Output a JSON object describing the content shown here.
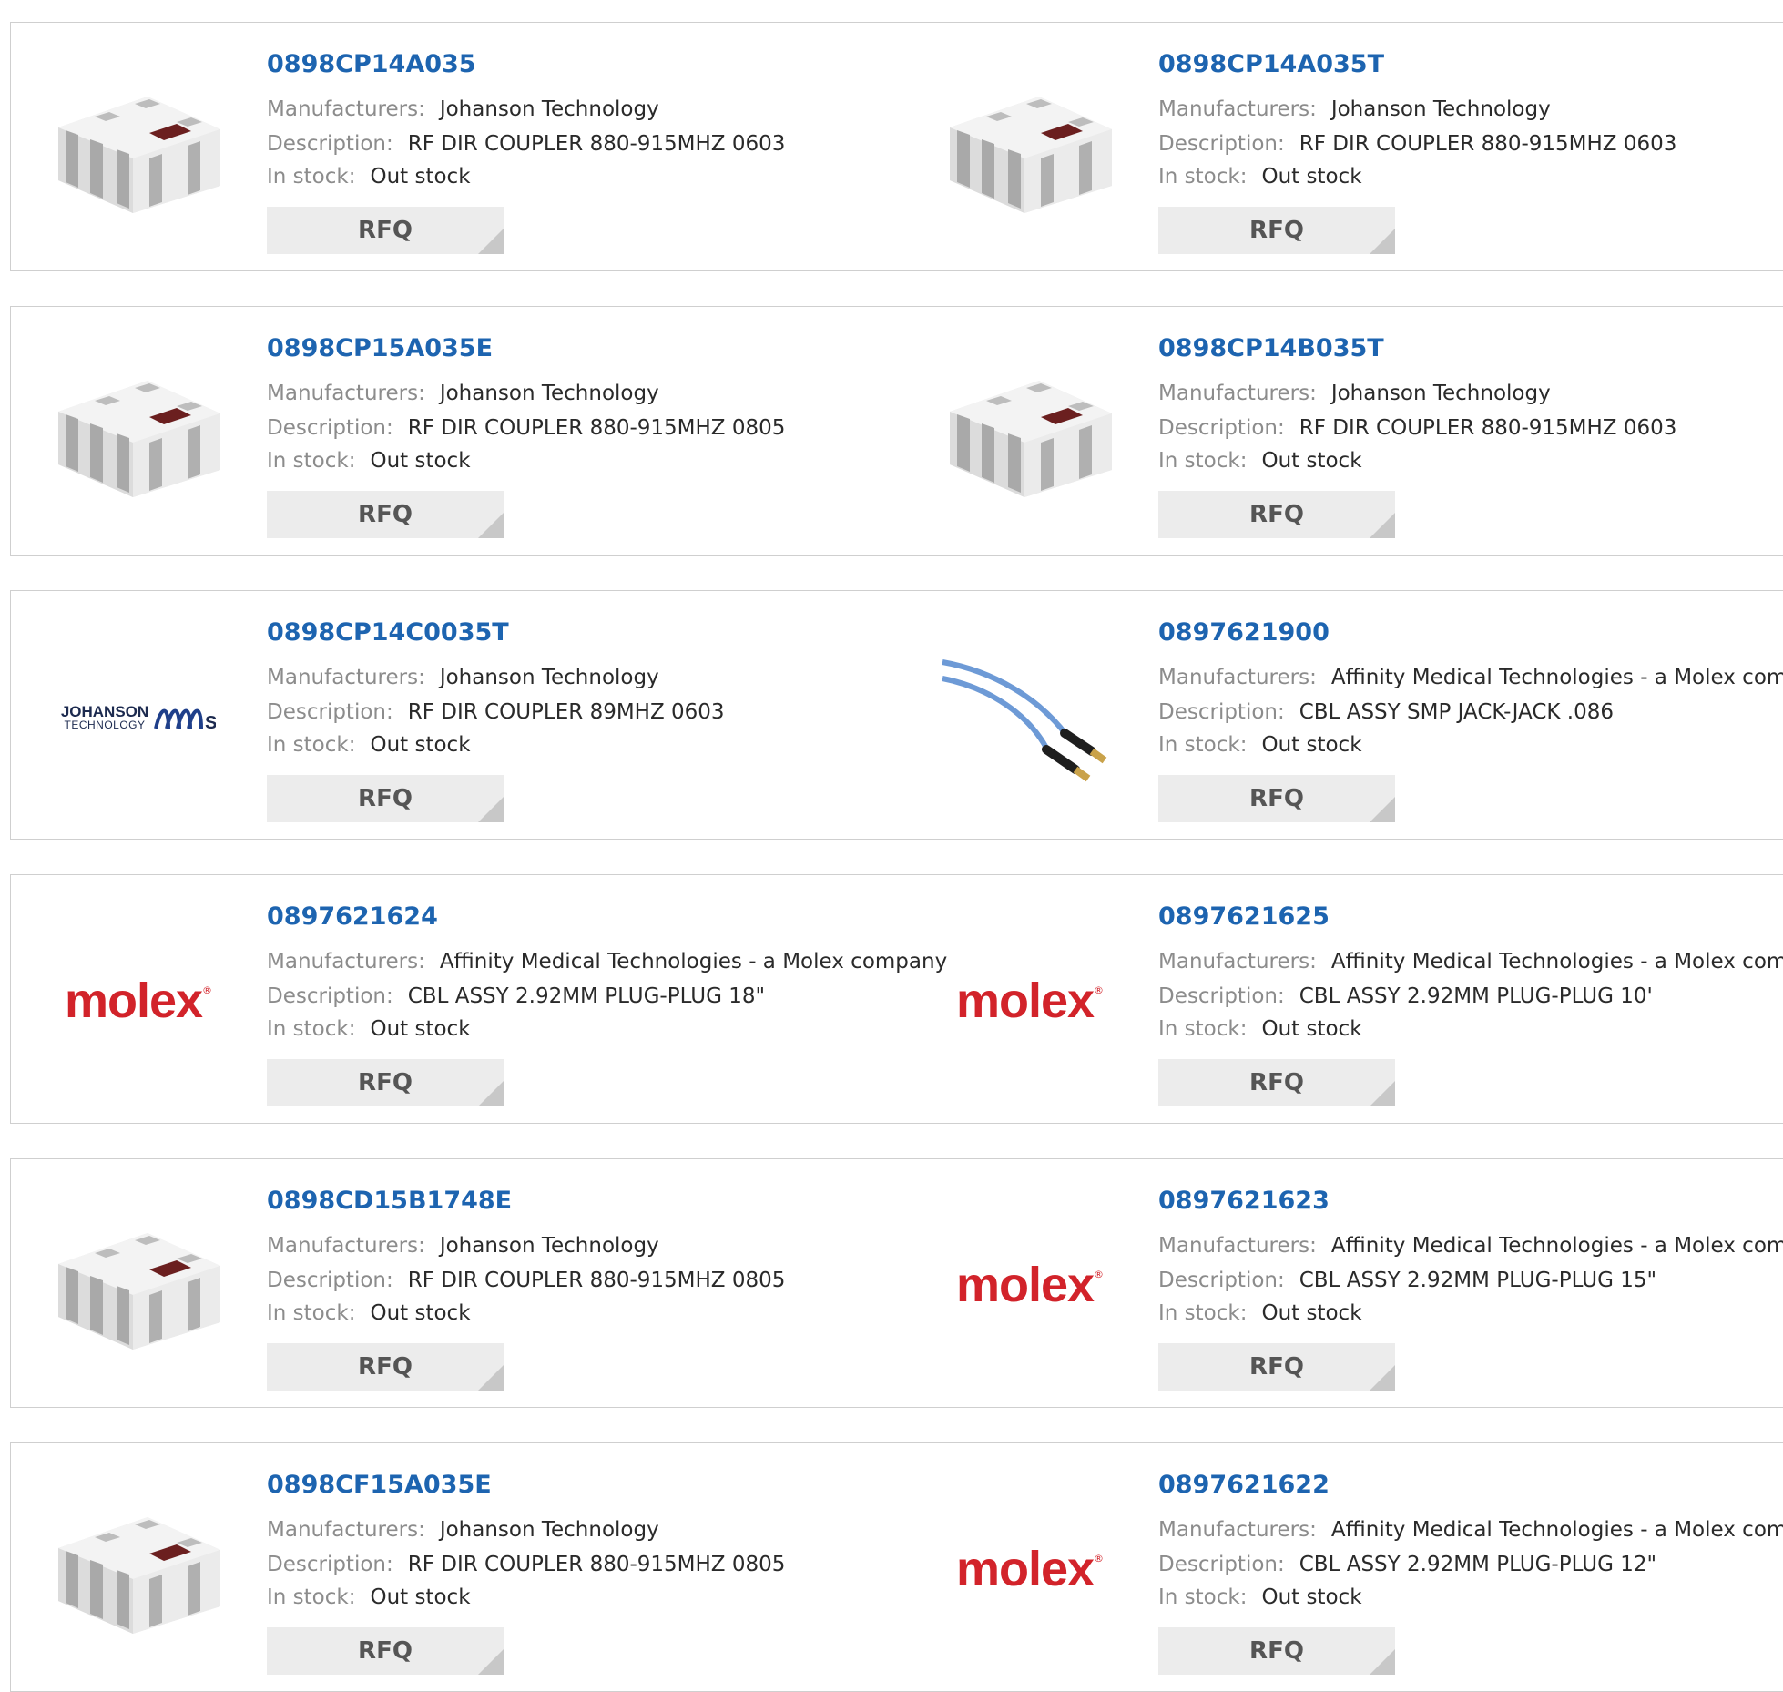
{
  "labels": {
    "manufacturer": "Manufacturers:",
    "description": "Description:",
    "stock": "In stock:",
    "rfq": "RFQ"
  },
  "rows": [
    {
      "left": {
        "part_number": "0898CP14A035",
        "manufacturer": "Johanson Technology",
        "description": "RF DIR COUPLER 880-915MHZ 0603",
        "stock": "Out stock",
        "image": "chip-coupler"
      },
      "right": {
        "part_number": "0898CP14A035T",
        "manufacturer": "Johanson Technology",
        "description": "RF DIR COUPLER 880-915MHZ 0603",
        "stock": "Out stock",
        "image": "chip-coupler"
      }
    },
    {
      "left": {
        "part_number": "0898CP15A035E",
        "manufacturer": "Johanson Technology",
        "description": "RF DIR COUPLER 880-915MHZ 0805",
        "stock": "Out stock",
        "image": "chip-coupler"
      },
      "right": {
        "part_number": "0898CP14B035T",
        "manufacturer": "Johanson Technology",
        "description": "RF DIR COUPLER 880-915MHZ 0603",
        "stock": "Out stock",
        "image": "chip-coupler"
      }
    },
    {
      "left": {
        "part_number": "0898CP14C0035T",
        "manufacturer": "Johanson Technology",
        "description": "RF DIR COUPLER 89MHZ 0603",
        "stock": "Out stock",
        "image": "johanson-logo",
        "logo_text": "JOHANSON",
        "logo_subtext": "TECHNOLOGY"
      },
      "right": {
        "part_number": "0897621900",
        "manufacturer": "Affinity Medical Technologies - a Molex company",
        "description": "CBL ASSY SMP JACK-JACK .086",
        "stock": "Out stock",
        "image": "cable-assembly"
      }
    },
    {
      "left": {
        "part_number": "0897621624",
        "manufacturer": "Affinity Medical Technologies - a Molex company",
        "description": "CBL ASSY 2.92MM PLUG-PLUG 18\"",
        "stock": "Out stock",
        "image": "molex-logo",
        "logo_text": "molex"
      },
      "right": {
        "part_number": "0897621625",
        "manufacturer": "Affinity Medical Technologies - a Molex company",
        "description": "CBL ASSY 2.92MM PLUG-PLUG 10'",
        "stock": "Out stock",
        "image": "molex-logo",
        "logo_text": "molex"
      }
    },
    {
      "left": {
        "part_number": "0898CD15B1748E",
        "manufacturer": "Johanson Technology",
        "description": "RF DIR COUPLER 880-915MHZ 0805",
        "stock": "Out stock",
        "image": "chip-coupler"
      },
      "right": {
        "part_number": "0897621623",
        "manufacturer": "Affinity Medical Technologies - a Molex company",
        "description": "CBL ASSY 2.92MM PLUG-PLUG 15\"",
        "stock": "Out stock",
        "image": "molex-logo",
        "logo_text": "molex"
      }
    },
    {
      "left": {
        "part_number": "0898CF15A035E",
        "manufacturer": "Johanson Technology",
        "description": "RF DIR COUPLER 880-915MHZ 0805",
        "stock": "Out stock",
        "image": "chip-coupler"
      },
      "right": {
        "part_number": "0897621622",
        "manufacturer": "Affinity Medical Technologies - a Molex company",
        "description": "CBL ASSY 2.92MM PLUG-PLUG 12\"",
        "stock": "Out stock",
        "image": "molex-logo",
        "logo_text": "molex"
      }
    }
  ],
  "colors": {
    "part_link": "#1d64b0",
    "label": "#8c8c8c",
    "value": "#2a2a2a",
    "rfq_bg": "#ececec",
    "molex_red": "#d2232a"
  }
}
